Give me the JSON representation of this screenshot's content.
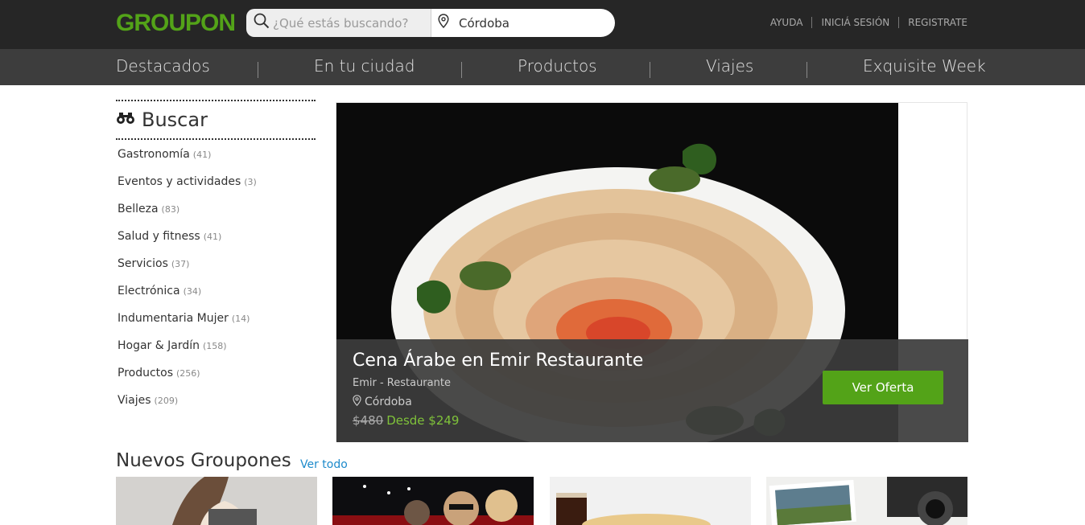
{
  "header": {
    "logo": "GROUPON",
    "search_placeholder": "¿Qué estás buscando?",
    "location_value": "Córdoba",
    "links": [
      "AYUDA",
      "INICIÁ SESIÓN",
      "REGISTRATE"
    ]
  },
  "nav": [
    "Destacados",
    "En tu ciudad",
    "Productos",
    "Viajes",
    "Exquisite Week"
  ],
  "sidebar": {
    "title": "Buscar",
    "categories": [
      {
        "label": "Gastronomía",
        "count": "(41)"
      },
      {
        "label": "Eventos y actividades",
        "count": "(3)"
      },
      {
        "label": "Belleza",
        "count": "(83)"
      },
      {
        "label": "Salud y fitness",
        "count": "(41)"
      },
      {
        "label": "Servicios",
        "count": "(37)"
      },
      {
        "label": "Electrónica",
        "count": "(34)"
      },
      {
        "label": "Indumentaria Mujer",
        "count": "(14)"
      },
      {
        "label": "Hogar & Jardín",
        "count": "(158)"
      },
      {
        "label": "Productos",
        "count": "(256)"
      },
      {
        "label": "Viajes",
        "count": "(209)"
      }
    ]
  },
  "hero": {
    "title": "Cena Árabe en Emir Restaurante",
    "merchant": "Emir - Restaurante",
    "location": "Córdoba",
    "old_price": "$480",
    "new_price": "Desde $249",
    "cta": "Ver Oferta"
  },
  "nuevos": {
    "title": "Nuevos Groupones",
    "link": "Ver todo"
  },
  "colors": {
    "brand_green": "#53a318",
    "price_green": "#7fc23a",
    "link_blue": "#1d8acb",
    "header_bg": "#262626",
    "nav_bg": "#3d3d3d"
  }
}
